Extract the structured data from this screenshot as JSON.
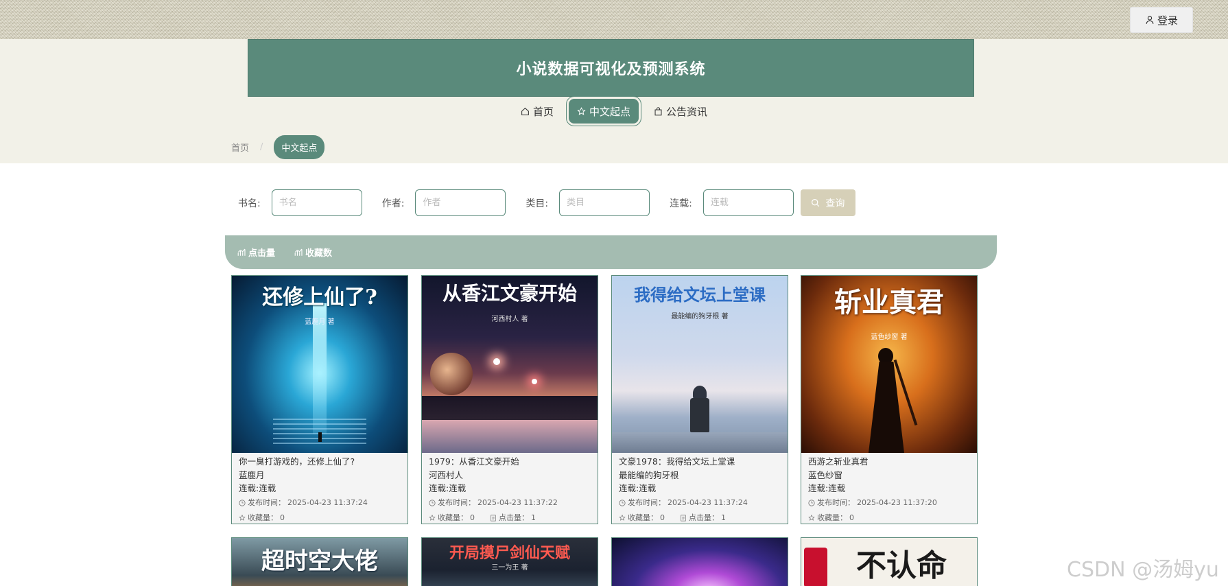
{
  "header": {
    "login_label": "登录",
    "title": "小说数据可视化及预测系统"
  },
  "nav": {
    "items": [
      {
        "label": "首页",
        "icon": "home-icon"
      },
      {
        "label": "中文起点",
        "icon": "star-icon",
        "active": true
      },
      {
        "label": "公告资讯",
        "icon": "bag-icon"
      }
    ]
  },
  "breadcrumb": {
    "home": "首页",
    "current": "中文起点"
  },
  "search": {
    "fields": [
      {
        "label": "书名:",
        "placeholder": "书名"
      },
      {
        "label": "作者:",
        "placeholder": "作者"
      },
      {
        "label": "类目:",
        "placeholder": "类目"
      },
      {
        "label": "连载:",
        "placeholder": "连载"
      }
    ],
    "query_label": "查询"
  },
  "sort": {
    "items": [
      "点击量",
      "收藏数"
    ]
  },
  "books": [
    {
      "cover_title": "还修上仙了?",
      "cover_author": "蓝鹿月 著",
      "title": "你一臭打游戏的，还修上仙了?",
      "author": "蓝鹿月",
      "status": "连载:连载",
      "publish_label": "发布时间：",
      "publish_time": "2025-04-23 11:37:24",
      "fav_label": "收藏量：",
      "fav": "0",
      "clicks_label": "",
      "clicks": ""
    },
    {
      "cover_title": "从香江文豪开始",
      "cover_author": "河西村人 著",
      "title": "1979：从香江文豪开始",
      "author": "河西村人",
      "status": "连载:连载",
      "publish_label": "发布时间：",
      "publish_time": "2025-04-23 11:37:22",
      "fav_label": "收藏量：",
      "fav": "0",
      "clicks_label": "点击量：",
      "clicks": "1"
    },
    {
      "cover_title": "我得给文坛上堂课",
      "cover_author": "最能编的狗牙根 著",
      "title": "文豪1978：我得给文坛上堂课",
      "author": "最能编的狗牙根",
      "status": "连载:连载",
      "publish_label": "发布时间：",
      "publish_time": "2025-04-23 11:37:24",
      "fav_label": "收藏量：",
      "fav": "0",
      "clicks_label": "点击量：",
      "clicks": "1"
    },
    {
      "cover_title": "斩业真君",
      "cover_author": "蓝色纱窗 著",
      "title": "西游之斩业真君",
      "author": "蓝色纱窗",
      "status": "连载:连载",
      "publish_label": "发布时间：",
      "publish_time": "2025-04-23 11:37:20",
      "fav_label": "收藏量：",
      "fav": "0",
      "clicks_label": "",
      "clicks": ""
    }
  ],
  "books_row2": [
    {
      "cover_title": "超时空大佬"
    },
    {
      "cover_title": "开局摸尸剑仙天赋",
      "cover_author": "三一为王 著"
    },
    {
      "cover_title": ""
    },
    {
      "cover_title": "不认命"
    }
  ],
  "watermark": "CSDN @汤姆yu",
  "colors": {
    "accent": "#5a8a7b",
    "sort_bar": "#a4bcb1",
    "query_button": "#d6d0b8",
    "header_bg": "#f2f1e8"
  }
}
